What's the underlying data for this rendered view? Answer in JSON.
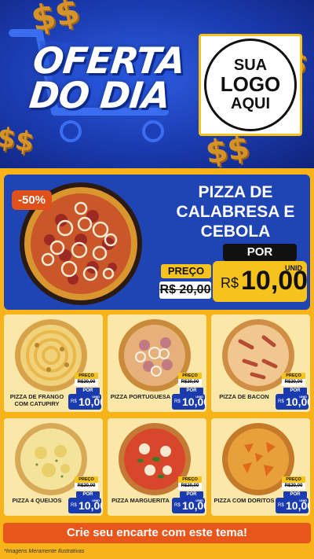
{
  "header": {
    "headline_line1": "OFERTA",
    "headline_line2": "DO DIA",
    "logo_line1": "SUA",
    "logo_line2": "LOGO",
    "logo_line3": "AQUI"
  },
  "featured": {
    "discount_badge": "-50%",
    "title": "PIZZA DE CALABRESA E CEBOLA",
    "preco_label": "PREÇO",
    "old_price": "R$ 20,00",
    "por_label": "POR",
    "currency": "R$",
    "new_price": "10,00",
    "unit": "UNID"
  },
  "products": [
    {
      "name": "PIZZA DE FRANGO COM CATUPIRY",
      "preco_label": "PREÇO",
      "old_price": "R$20,00",
      "por_label": "POR",
      "currency": "R$",
      "price": "10,00",
      "unit": "UNID",
      "style": "frango"
    },
    {
      "name": "PIZZA PORTUGUESA",
      "preco_label": "PREÇO",
      "old_price": "R$20,00",
      "por_label": "POR",
      "currency": "R$",
      "price": "10,00",
      "unit": "UNID",
      "style": "portuguesa"
    },
    {
      "name": "PIZZA DE BACON",
      "preco_label": "PREÇO",
      "old_price": "R$20,00",
      "por_label": "POR",
      "currency": "R$",
      "price": "10,00",
      "unit": "UNID",
      "style": "bacon"
    },
    {
      "name": "PIZZA 4 QUEIJOS",
      "preco_label": "PREÇO",
      "old_price": "R$20,00",
      "por_label": "POR",
      "currency": "R$",
      "price": "10,00",
      "unit": "UNID",
      "style": "queijos"
    },
    {
      "name": "PIZZA MARGUERITA",
      "preco_label": "PREÇO",
      "old_price": "R$20,00",
      "por_label": "POR",
      "currency": "R$",
      "price": "10,00",
      "unit": "UNID",
      "style": "marguerita"
    },
    {
      "name": "PIZZA COM DORITOS",
      "preco_label": "PREÇO",
      "old_price": "R$20,00",
      "por_label": "POR",
      "currency": "R$",
      "price": "10,00",
      "unit": "UNID",
      "style": "doritos"
    }
  ],
  "cta": {
    "label": "Crie seu encarte com este tema!"
  },
  "footnote": "*Imagens Meramente Ilustrativas",
  "colors": {
    "brand_blue": "#1a3bb0",
    "accent_yellow": "#f6c31c",
    "cta_orange": "#e8561c",
    "background_yellow": "#f7b319"
  }
}
